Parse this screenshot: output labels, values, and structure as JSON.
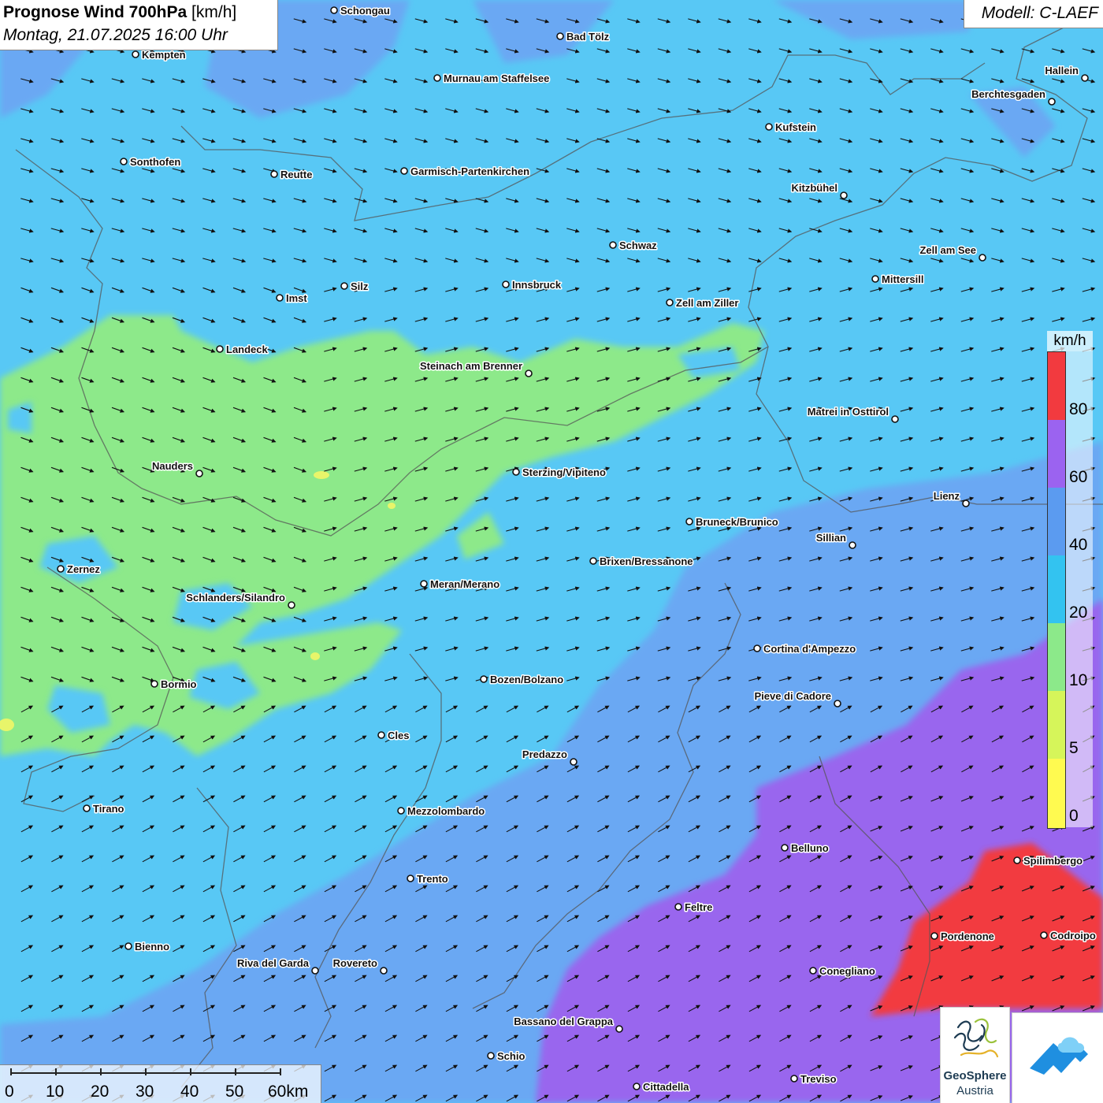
{
  "title": {
    "main": "Prognose Wind 700hPa",
    "unit": "[km/h]",
    "datetime": "Montag, 21.07.2025 16:00 Uhr"
  },
  "model_label": "Modell: C-LAEF",
  "legend": {
    "unit": "km/h",
    "ticks": [
      "80",
      "60",
      "40",
      "20",
      "10",
      "5",
      "0"
    ],
    "classes": [
      {
        "range": "0-5",
        "color": "#fffa50"
      },
      {
        "range": "5-10",
        "color": "#d6f55a"
      },
      {
        "range": "10-20",
        "color": "#8ce98a"
      },
      {
        "range": "20-40",
        "color": "#33c3f0"
      },
      {
        "range": "40-60",
        "color": "#5b9bf0"
      },
      {
        "range": "60-80",
        "color": "#9b63f0"
      },
      {
        "range": ">80",
        "color": "#f23a3f"
      }
    ]
  },
  "scale": {
    "ticks": [
      "0",
      "10",
      "20",
      "30",
      "40",
      "50",
      "60km"
    ]
  },
  "logos": {
    "geosphere_name": "GeoSphere",
    "geosphere_sub": "Austria"
  },
  "icons": {
    "wind_arrow": "wind-arrow-icon",
    "city_marker": "city-marker-icon",
    "geosphere_logo": "geosphere-logo-icon",
    "app_logo": "app-logo-icon"
  },
  "cities": [
    {
      "name": "Schongau"
    },
    {
      "name": "Bad Tölz"
    },
    {
      "name": "Kempten"
    },
    {
      "name": "Murnau am Staffelsee"
    },
    {
      "name": "Hallein"
    },
    {
      "name": "Berchtesgaden"
    },
    {
      "name": "Kufstein"
    },
    {
      "name": "Sonthofen"
    },
    {
      "name": "Reutte"
    },
    {
      "name": "Garmisch-Partenkirchen"
    },
    {
      "name": "Kitzbühel"
    },
    {
      "name": "Schwaz"
    },
    {
      "name": "Zell am See"
    },
    {
      "name": "Mittersill"
    },
    {
      "name": "Innsbruck"
    },
    {
      "name": "Silz"
    },
    {
      "name": "Imst"
    },
    {
      "name": "Zell am Ziller"
    },
    {
      "name": "Landeck"
    },
    {
      "name": "Steinach am Brenner"
    },
    {
      "name": "Matrei in Osttirol"
    },
    {
      "name": "Nauders"
    },
    {
      "name": "Sterzing/Vipiteno"
    },
    {
      "name": "Lienz"
    },
    {
      "name": "Bruneck/Brunico"
    },
    {
      "name": "Sillian"
    },
    {
      "name": "Brixen/Bressanone"
    },
    {
      "name": "Zernez"
    },
    {
      "name": "Meran/Merano"
    },
    {
      "name": "Schlanders/Silandro"
    },
    {
      "name": "Cortina d'Ampezzo"
    },
    {
      "name": "Bozen/Bolzano"
    },
    {
      "name": "Bormio"
    },
    {
      "name": "Pieve di Cadore"
    },
    {
      "name": "Cles"
    },
    {
      "name": "Predazzo"
    },
    {
      "name": "Tirano"
    },
    {
      "name": "Mezzolombardo"
    },
    {
      "name": "Belluno"
    },
    {
      "name": "Spilimbergo"
    },
    {
      "name": "Trento"
    },
    {
      "name": "Feltre"
    },
    {
      "name": "Pordenone"
    },
    {
      "name": "Codroipo"
    },
    {
      "name": "Bienno"
    },
    {
      "name": "Riva del Garda"
    },
    {
      "name": "Rovereto"
    },
    {
      "name": "Conegliano"
    },
    {
      "name": "Bassano del Grappa"
    },
    {
      "name": "Schio"
    },
    {
      "name": "Treviso"
    },
    {
      "name": "Cittadella"
    }
  ]
}
